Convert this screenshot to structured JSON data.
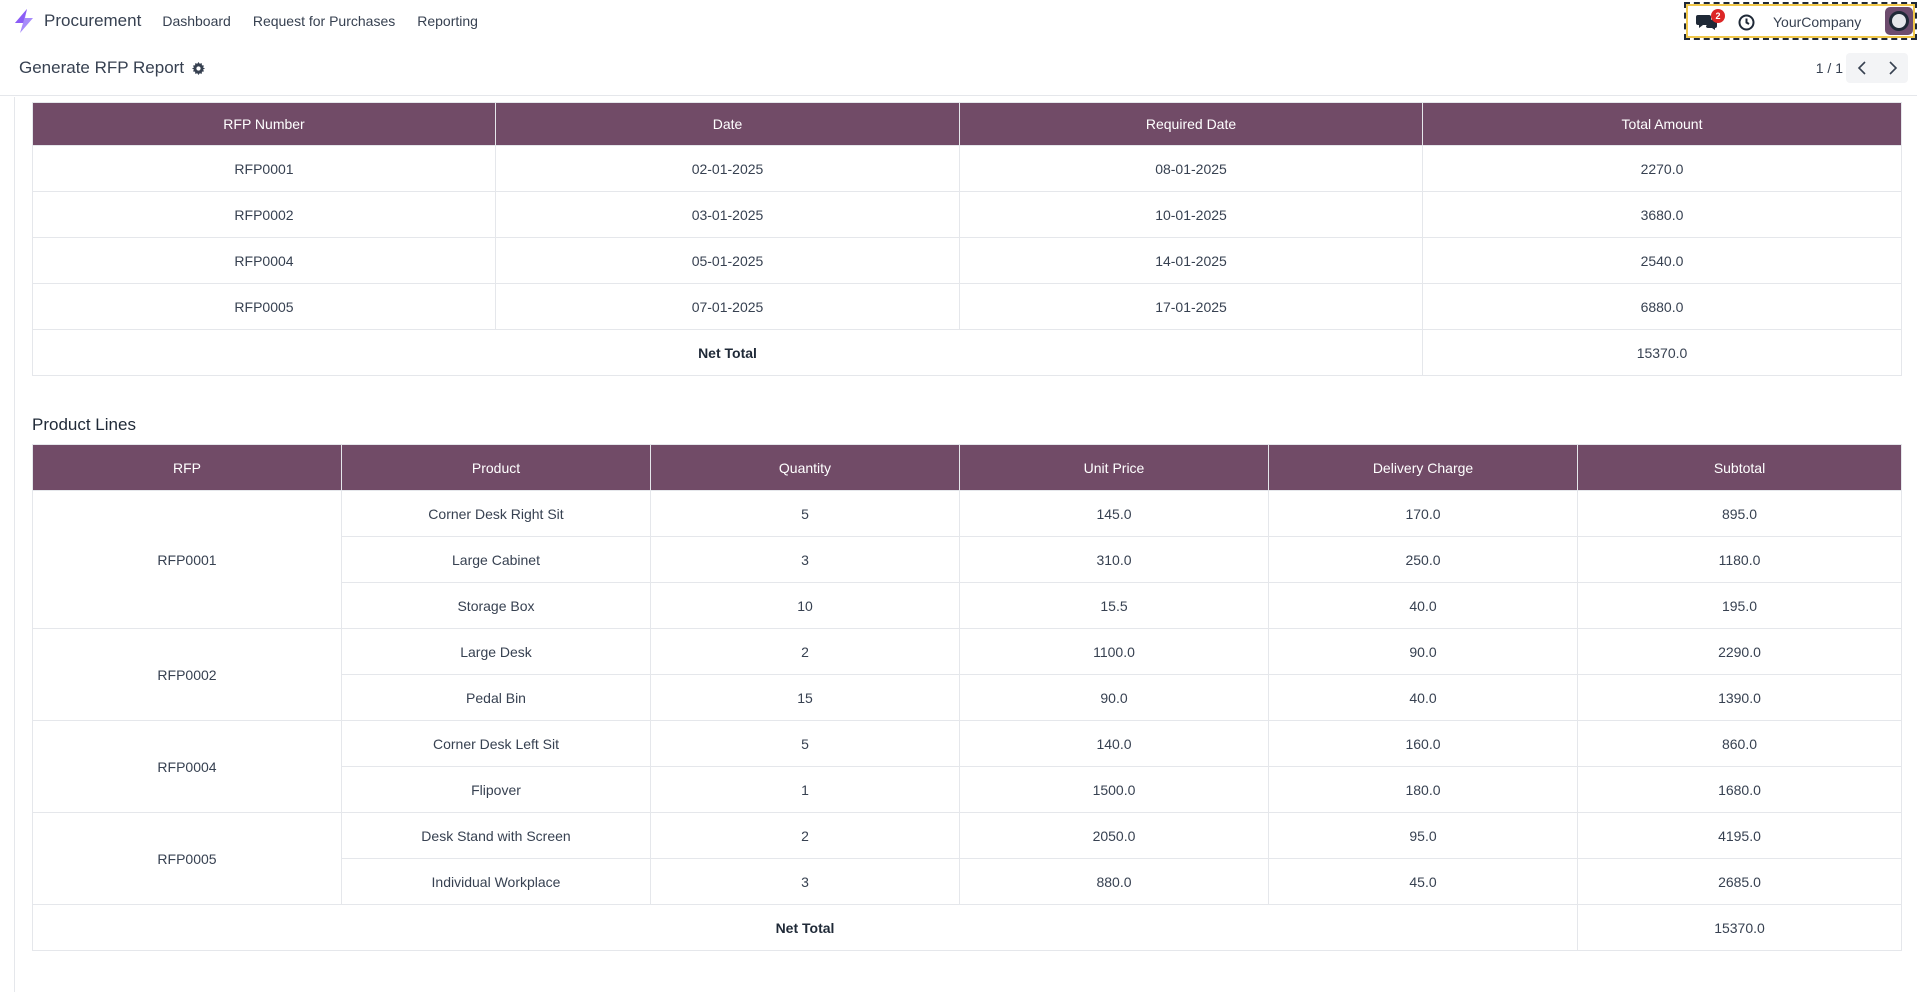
{
  "navbar": {
    "app_name": "Procurement",
    "menu": [
      "Dashboard",
      "Request for Purchases",
      "Reporting"
    ],
    "message_count": "2",
    "company": "YourCompany"
  },
  "control": {
    "breadcrumb": "Generate RFP Report",
    "pager": "1 / 1"
  },
  "rfp_table": {
    "headers": [
      "RFP Number",
      "Date",
      "Required Date",
      "Total Amount"
    ],
    "rows": [
      [
        "RFP0001",
        "02-01-2025",
        "08-01-2025",
        "2270.0"
      ],
      [
        "RFP0002",
        "03-01-2025",
        "10-01-2025",
        "3680.0"
      ],
      [
        "RFP0004",
        "05-01-2025",
        "14-01-2025",
        "2540.0"
      ],
      [
        "RFP0005",
        "07-01-2025",
        "17-01-2025",
        "6880.0"
      ]
    ],
    "net_total_label": "Net Total",
    "net_total": "15370.0"
  },
  "product_lines": {
    "title": "Product Lines",
    "headers": [
      "RFP",
      "Product",
      "Quantity",
      "Unit Price",
      "Delivery Charge",
      "Subtotal"
    ],
    "groups": [
      {
        "rfp": "RFP0001",
        "lines": [
          [
            "Corner Desk Right Sit",
            "5",
            "145.0",
            "170.0",
            "895.0"
          ],
          [
            "Large Cabinet",
            "3",
            "310.0",
            "250.0",
            "1180.0"
          ],
          [
            "Storage Box",
            "10",
            "15.5",
            "40.0",
            "195.0"
          ]
        ]
      },
      {
        "rfp": "RFP0002",
        "lines": [
          [
            "Large Desk",
            "2",
            "1100.0",
            "90.0",
            "2290.0"
          ],
          [
            "Pedal Bin",
            "15",
            "90.0",
            "40.0",
            "1390.0"
          ]
        ]
      },
      {
        "rfp": "RFP0004",
        "lines": [
          [
            "Corner Desk Left Sit",
            "5",
            "140.0",
            "160.0",
            "860.0"
          ],
          [
            "Flipover",
            "1",
            "1500.0",
            "180.0",
            "1680.0"
          ]
        ]
      },
      {
        "rfp": "RFP0005",
        "lines": [
          [
            "Desk Stand with Screen",
            "2",
            "2050.0",
            "95.0",
            "4195.0"
          ],
          [
            "Individual Workplace",
            "3",
            "880.0",
            "45.0",
            "2685.0"
          ]
        ]
      }
    ],
    "net_total_label": "Net Total",
    "net_total": "15370.0"
  },
  "colors": {
    "header_bg": "#714b67",
    "brand": "#8b5cf6"
  }
}
